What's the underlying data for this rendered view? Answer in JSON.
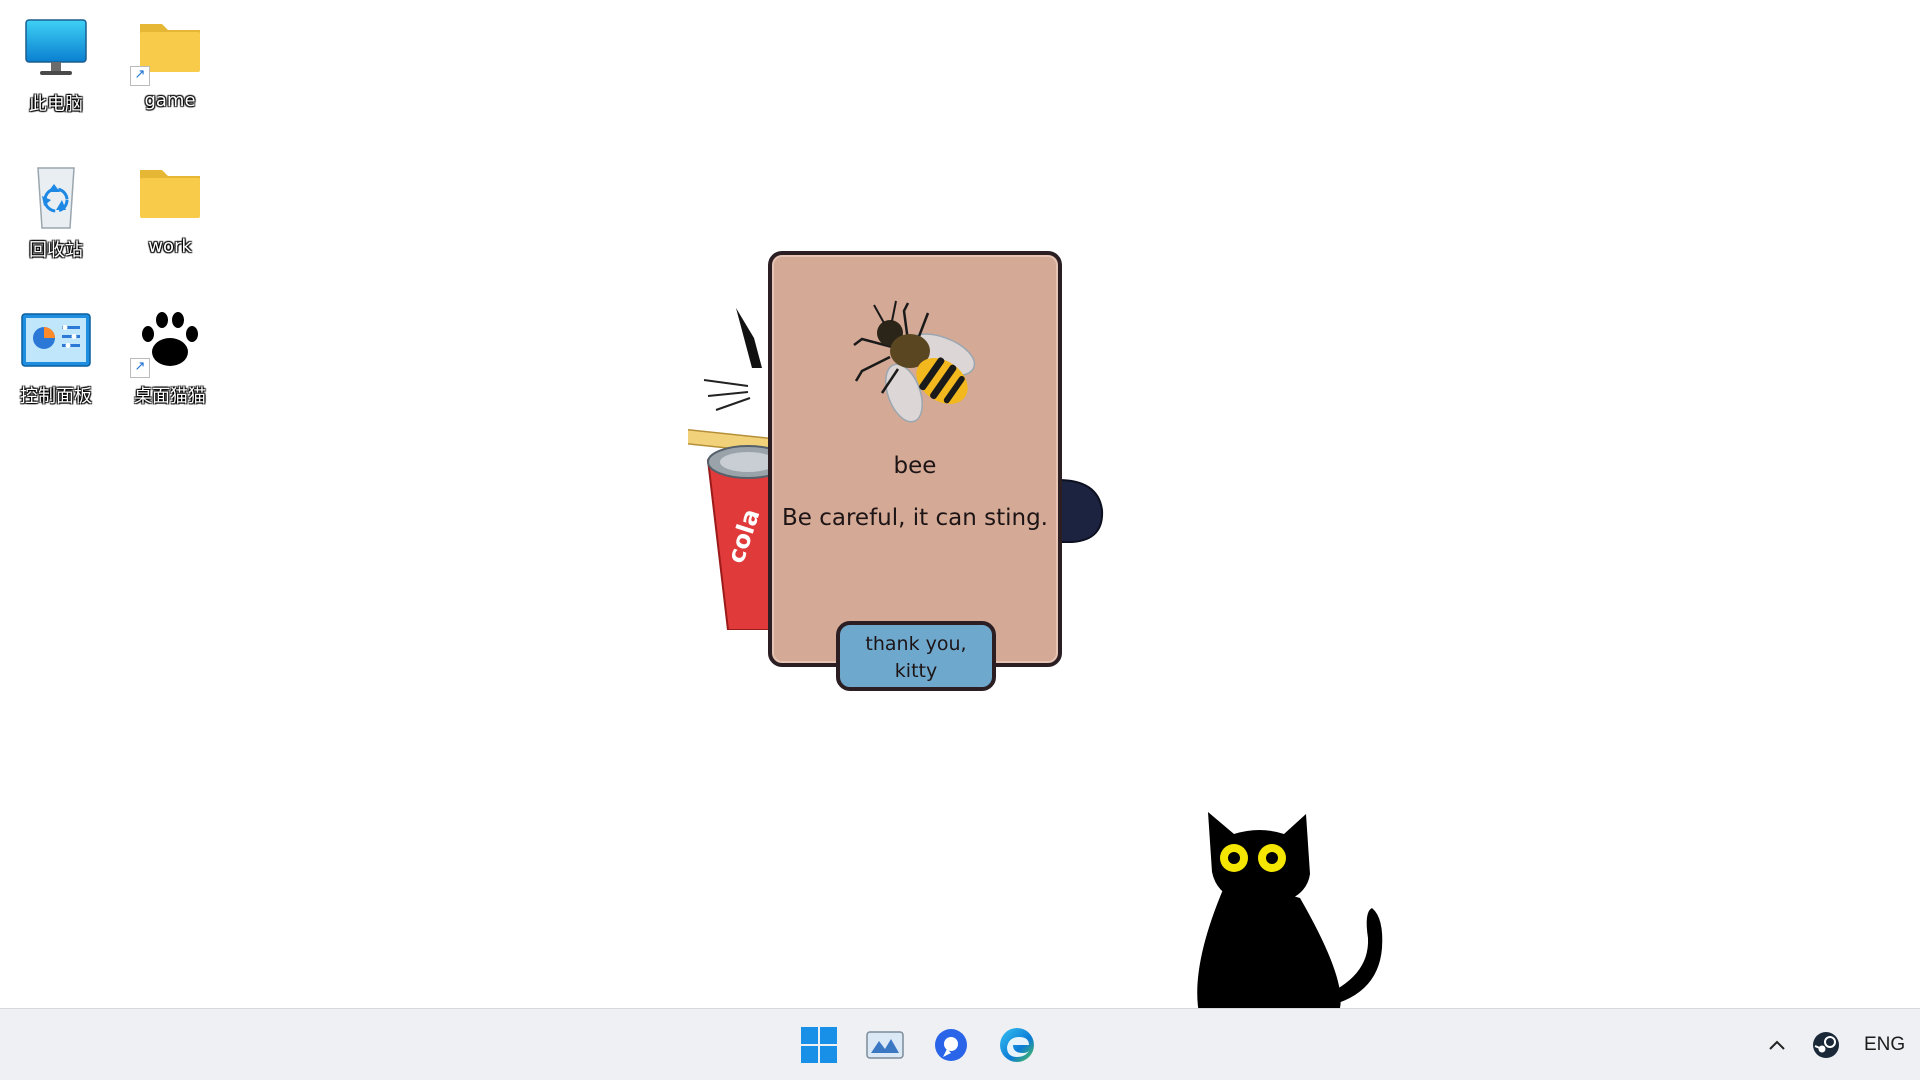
{
  "desktop": {
    "icons": [
      {
        "label": "此电脑",
        "icon": "monitor-icon"
      },
      {
        "label": "game",
        "icon": "folder-icon",
        "shortcut": true
      },
      {
        "label": "回收站",
        "icon": "recycle-bin-icon"
      },
      {
        "label": "work",
        "icon": "folder-icon"
      },
      {
        "label": "控制面板",
        "icon": "control-panel-icon"
      },
      {
        "label": "桌面猫猫",
        "icon": "paw-icon",
        "shortcut": true
      }
    ]
  },
  "dialog": {
    "creature_icon": "bee-icon",
    "name": "bee",
    "description": "Be careful, it can sting.",
    "button_line1": "thank you,",
    "button_line2": "kitty"
  },
  "decor": {
    "can_text": "cola"
  },
  "taskbar": {
    "items": [
      "windows-start-icon",
      "photos-icon",
      "chat-icon",
      "edge-icon"
    ],
    "tray": {
      "chevron": "chevron-up-icon",
      "steam": "steam-icon",
      "language": "ENG"
    }
  },
  "colors": {
    "dialog_bg": "#d4a995",
    "dialog_border": "#2b1f24",
    "button_bg": "#6ea8cc",
    "taskbar_bg": "#eef0f4",
    "folder": "#f8cc4a",
    "cat": "#000000",
    "cat_eyes": "#f5e600"
  }
}
